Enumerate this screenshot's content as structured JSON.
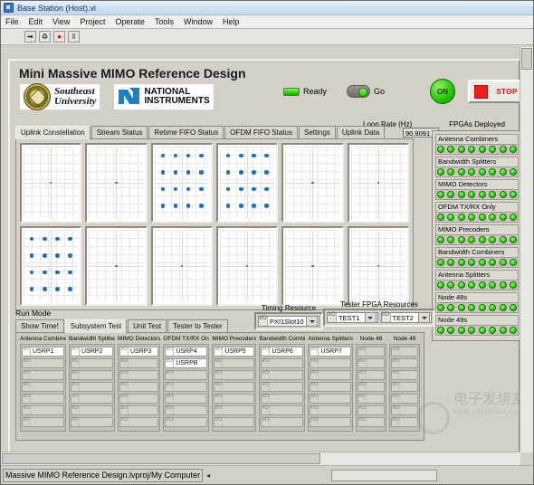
{
  "window": {
    "title": "Base Station (Host).vi",
    "icon": "labview-vi-icon"
  },
  "menubar": [
    "File",
    "Edit",
    "View",
    "Project",
    "Operate",
    "Tools",
    "Window",
    "Help"
  ],
  "toolbar": [
    {
      "name": "run-button",
      "glyph": "➡"
    },
    {
      "name": "run-continuously-button",
      "glyph": "♻"
    },
    {
      "name": "abort-button",
      "glyph": "●"
    },
    {
      "name": "pause-button",
      "glyph": "‖"
    }
  ],
  "header": {
    "title": "Mini Massive MIMO Reference Design",
    "university_logo": {
      "line1": "Southeast",
      "line2": "University"
    },
    "ni_logo": {
      "line1": "NATIONAL",
      "line2": "INSTRUMENTS"
    },
    "ready_label": "Ready",
    "go_label": "Go",
    "on_label": "ON",
    "stop_label": "STOP",
    "colors": {
      "led_green": "#28d406",
      "stop_red": "#ee1c1c",
      "on_green": "#22c404"
    }
  },
  "tabs": [
    {
      "label": "Uplink Constellation",
      "active": true
    },
    {
      "label": "Stream Status",
      "active": false
    },
    {
      "label": "Retime FIFO Status",
      "active": false
    },
    {
      "label": "OFDM FIFO Status",
      "active": false
    },
    {
      "label": "Settings",
      "active": false
    },
    {
      "label": "Uplink Data",
      "active": false
    }
  ],
  "loop_rate": {
    "label": "Loop Rate (Hz)",
    "value": "90.9091"
  },
  "constellations": [
    {
      "name": "plot-1",
      "type": "single-point"
    },
    {
      "name": "plot-2",
      "type": "single-point"
    },
    {
      "name": "plot-3",
      "type": "qam16"
    },
    {
      "name": "plot-4",
      "type": "qam16"
    },
    {
      "name": "plot-5",
      "type": "single-point"
    },
    {
      "name": "plot-6",
      "type": "single-point"
    },
    {
      "name": "plot-7",
      "type": "qam16"
    },
    {
      "name": "plot-8",
      "type": "single-point"
    },
    {
      "name": "plot-9",
      "type": "single-point"
    },
    {
      "name": "plot-10",
      "type": "single-point"
    },
    {
      "name": "plot-11",
      "type": "single-point"
    },
    {
      "name": "plot-12",
      "type": "single-point"
    }
  ],
  "fpgas_deployed": {
    "title": "FPGAs Deployed",
    "groups": [
      {
        "label": "Antenna Combiners",
        "led_count": 8
      },
      {
        "label": "Bandwidth Splitters",
        "led_count": 8
      },
      {
        "label": "MIMO Detectors",
        "led_count": 8
      },
      {
        "label": "OFDM TX/RX Only",
        "led_count": 8
      },
      {
        "label": "MIMO Precoders",
        "led_count": 8
      },
      {
        "label": "Bandwidth Combiners",
        "led_count": 8
      },
      {
        "label": "Antenna Splitters",
        "led_count": 8
      },
      {
        "label": "Node 48s",
        "led_count": 8
      },
      {
        "label": "Node 49s",
        "led_count": 8
      }
    ]
  },
  "run_mode": {
    "label": "Run Mode",
    "tabs": [
      {
        "label": "Show Time!",
        "active": false
      },
      {
        "label": "Subsystem Test",
        "active": true
      },
      {
        "label": "Unit Test",
        "active": false
      },
      {
        "label": "Tester to Tester",
        "active": false
      }
    ]
  },
  "timing_resource": {
    "label": "Timing Resource",
    "value": "PXI1Slot10"
  },
  "tester_fpga_resources": {
    "label": "Tester FPGA Resources",
    "value1": "TEST1",
    "value2": "TEST2"
  },
  "resource_table": {
    "columns": [
      {
        "header": "Antenna Combiners",
        "values": [
          "USRP1",
          "",
          "",
          "",
          "",
          "",
          ""
        ]
      },
      {
        "header": "Bandwidth Splitters",
        "values": [
          "USRP2",
          "",
          "",
          "",
          "",
          "",
          ""
        ]
      },
      {
        "header": "MIMO Detectors",
        "values": [
          "USRP3",
          "",
          "",
          "",
          "",
          "",
          ""
        ]
      },
      {
        "header": "OFDM TX/RX Onlys",
        "values": [
          "USRP4",
          "USRPB",
          "",
          "",
          "",
          "",
          ""
        ]
      },
      {
        "header": "MIMO Precoders",
        "values": [
          "USRP5",
          "",
          "",
          "",
          "",
          "",
          ""
        ]
      },
      {
        "header": "Bandwidth Combiners",
        "values": [
          "USRP6",
          "",
          "",
          "",
          "",
          "",
          ""
        ]
      },
      {
        "header": "Antenna Splitters",
        "values": [
          "USRP7",
          "",
          "",
          "",
          "",
          "",
          ""
        ]
      },
      {
        "header": "Node 48",
        "values": [
          "",
          "",
          "",
          "",
          "",
          "",
          ""
        ]
      },
      {
        "header": "Node 49",
        "values": [
          "",
          "",
          "",
          "",
          "",
          "",
          ""
        ]
      }
    ]
  },
  "watermark": {
    "chinese": "电子发烧友",
    "url": "www.elecfans.com"
  },
  "statusbar": {
    "text": "Massive MIMO Reference Design.lvproj/My Computer",
    "arrow": "◂"
  }
}
